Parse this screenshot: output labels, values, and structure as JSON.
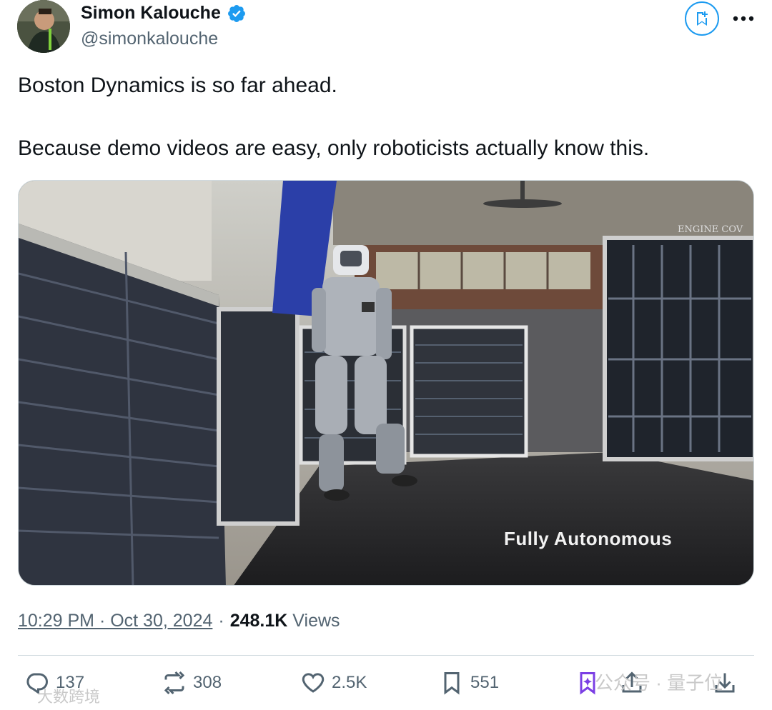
{
  "author": {
    "name": "Simon Kalouche",
    "handle": "@simonkalouche"
  },
  "tweet": {
    "text": "Boston Dynamics is so far ahead.\n\nBecause demo videos are easy, only roboticists actually know this."
  },
  "media": {
    "caption": "Fully Autonomous",
    "sign": "ENGINE COV"
  },
  "meta": {
    "timestamp": "10:29 PM · Oct 30, 2024",
    "separator": "·",
    "views_count": "248.1K",
    "views_label": "Views"
  },
  "actions": {
    "replies": "137",
    "reposts": "308",
    "likes": "2.5K",
    "bookmarks": "551"
  },
  "watermarks": {
    "left": "大数跨境",
    "right": "公众号 · 量子位"
  },
  "colors": {
    "accent": "#1d9bf0",
    "text": "#0f1419",
    "secondary": "#536471",
    "watermark_icon": "#7b3fe4"
  }
}
